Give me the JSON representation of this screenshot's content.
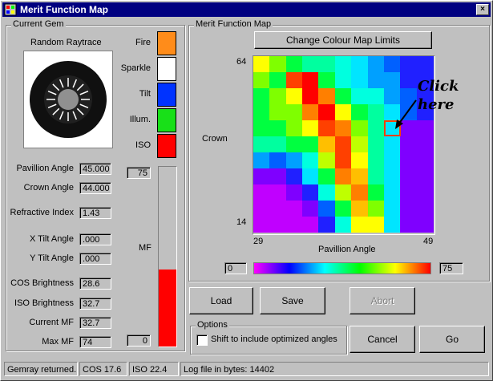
{
  "window": {
    "title": "Merit Function Map",
    "close_label": "×"
  },
  "current_gem": {
    "group_label": "Current Gem",
    "image_caption": "Random Raytrace",
    "fields": [
      {
        "label": "Pavillion Angle",
        "value": "45.000"
      },
      {
        "label": "Crown Angle",
        "value": "44.000"
      },
      {
        "label": "Refractive Index",
        "value": "1.43"
      },
      {
        "label": "X Tilt Angle",
        "value": ".000"
      },
      {
        "label": "Y Tilt Angle",
        "value": ".000"
      },
      {
        "label": "COS Brightness",
        "value": "28.6"
      },
      {
        "label": "ISO Brightness",
        "value": "32.7"
      },
      {
        "label": "Current MF",
        "value": "32.7"
      },
      {
        "label": "Max MF",
        "value": "74"
      }
    ],
    "swatches": [
      {
        "label": "Fire",
        "color": "#ff8c1a"
      },
      {
        "label": "Sparkle",
        "color": "#ffffff"
      },
      {
        "label": "Tilt",
        "color": "#0033ff"
      },
      {
        "label": "Illum.",
        "color": "#18e018"
      },
      {
        "label": "ISO",
        "color": "#ff0000"
      }
    ],
    "mf_bar": {
      "label": "MF",
      "top_value": "75",
      "bottom_value": "0",
      "fill_fraction": 0.43,
      "fill_color": "#ff0000"
    }
  },
  "map": {
    "group_label": "Merit Function Map",
    "change_button": "Change Colour Map Limits",
    "y_label": "Crown",
    "y_top": "64",
    "y_bottom": "14",
    "x_left": "29",
    "x_right": "49",
    "x_label": "Pavillion Angle",
    "scale_min": "0",
    "scale_max": "75",
    "annotation": "Click here",
    "grid": [
      [
        4,
        6,
        7,
        8,
        8,
        9,
        10,
        11,
        12,
        13,
        13
      ],
      [
        6,
        7,
        1,
        0,
        7,
        9,
        10,
        11,
        11,
        13,
        13
      ],
      [
        7,
        6,
        4,
        0,
        2,
        7,
        9,
        9,
        11,
        12,
        13
      ],
      [
        7,
        6,
        6,
        2,
        0,
        4,
        7,
        8,
        10,
        12,
        13
      ],
      [
        7,
        7,
        6,
        4,
        1,
        2,
        6,
        8,
        10,
        14,
        14
      ],
      [
        8,
        8,
        7,
        7,
        3,
        1,
        5,
        8,
        10,
        14,
        14
      ],
      [
        11,
        12,
        11,
        9,
        5,
        1,
        4,
        8,
        10,
        14,
        14
      ],
      [
        14,
        14,
        13,
        10,
        7,
        2,
        3,
        8,
        10,
        14,
        14
      ],
      [
        15,
        15,
        14,
        13,
        9,
        5,
        2,
        7,
        10,
        14,
        14
      ],
      [
        15,
        15,
        15,
        14,
        12,
        7,
        3,
        6,
        10,
        14,
        14
      ],
      [
        15,
        15,
        15,
        15,
        13,
        9,
        4,
        4,
        10,
        14,
        14
      ]
    ],
    "palette": [
      "#ff0000",
      "#ff4000",
      "#ff7f00",
      "#ffbf00",
      "#ffff00",
      "#bfff00",
      "#7fff00",
      "#00ff40",
      "#00ff9f",
      "#00ffdf",
      "#00e5ff",
      "#00a0ff",
      "#0060ff",
      "#2020ff",
      "#7f00ff",
      "#c000ff"
    ],
    "selected_cell": {
      "row": 4,
      "col": 8
    }
  },
  "buttons": {
    "load": "Load",
    "save": "Save",
    "abort": "Abort",
    "cancel": "Cancel",
    "go": "Go"
  },
  "options": {
    "group_label": "Options",
    "checkbox_label": "Shift to include optimized angles",
    "checked": false
  },
  "status": {
    "message": "Gemray returned.",
    "cos": "COS  17.6",
    "iso": "ISO  22.4",
    "log": "Log file in bytes:  14402"
  }
}
